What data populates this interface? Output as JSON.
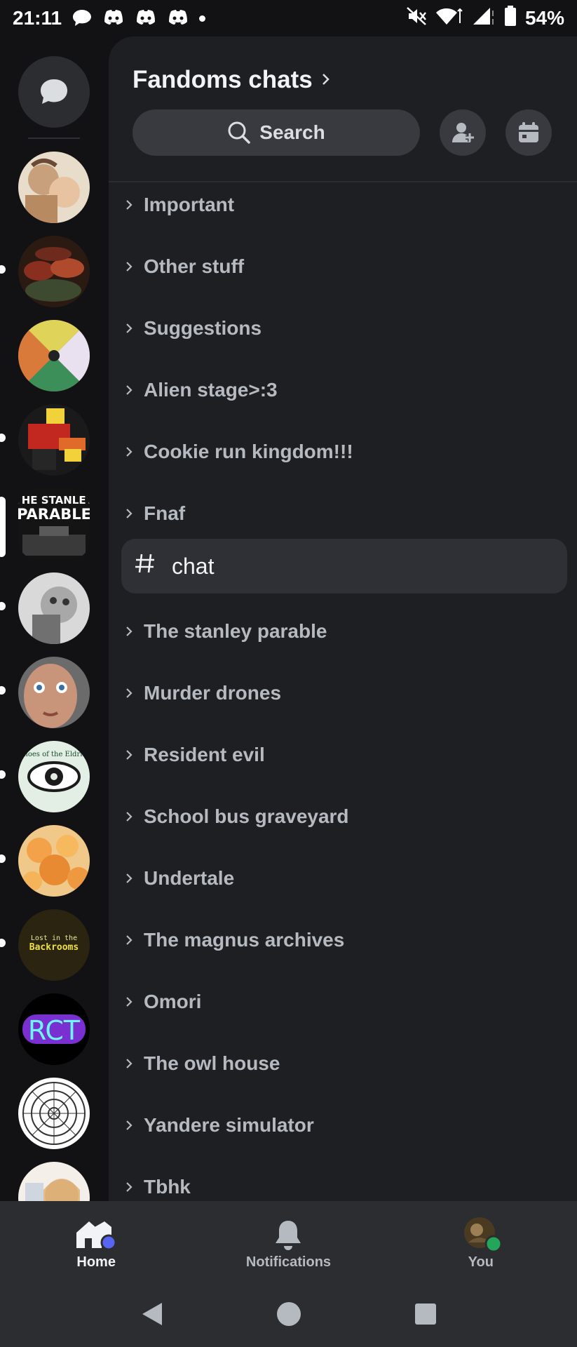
{
  "status_bar": {
    "time": "21:11",
    "battery": "54%"
  },
  "server": {
    "title": "Fandoms chats",
    "search_label": "Search"
  },
  "categories": [
    "Important",
    "Other stuff",
    "Suggestions",
    "Alien stage>:3",
    "Cookie run kingdom!!!",
    "Fnaf",
    "The stanley parable",
    "Murder drones",
    "Resident evil",
    "School bus graveyard",
    "Undertale",
    "The magnus archives",
    "Omori",
    "The owl house",
    "Yandere simulator",
    "Tbhk"
  ],
  "selected_channel": {
    "name": "chat"
  },
  "server_icons": {
    "stanley_text_1": "THE STANLEY",
    "stanley_text_2": "PARABLE",
    "echoes_text": "Echoes of the Eldritch",
    "backrooms_text_1": "Lost in the",
    "backrooms_text_2": "Backrooms",
    "rct_text": "RCT"
  },
  "bottom_nav": {
    "home": "Home",
    "notifications": "Notifications",
    "you": "You"
  },
  "colors": {
    "background": "#121214",
    "panel": "#1e1f22",
    "accent": "#5865f2",
    "online": "#23a55a"
  }
}
